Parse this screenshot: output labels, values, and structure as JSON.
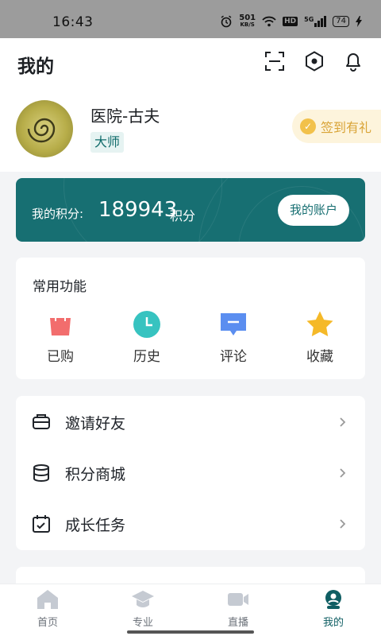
{
  "status_bar": {
    "time": "16:43",
    "net_speed_value": "501",
    "net_speed_unit": "KB/S",
    "hd_badge": "HD",
    "signal_label": "5G",
    "battery": "74",
    "icons": [
      "alarm-icon",
      "wifi-icon",
      "signal-icon",
      "battery-icon",
      "charging-icon"
    ]
  },
  "header": {
    "title": "我的",
    "icons": [
      "scan-icon",
      "settings-icon",
      "bell-icon"
    ]
  },
  "profile": {
    "name": "医院-古夫",
    "level": "大师",
    "checkin_label": "签到有礼"
  },
  "points": {
    "label": "我的积分:",
    "value": "189943",
    "unit": "积分",
    "account_button": "我的账户"
  },
  "common_functions": {
    "title": "常用功能",
    "items": [
      {
        "label": "已购",
        "icon": "shopping-bag-icon",
        "color": "#f26d6d"
      },
      {
        "label": "历史",
        "icon": "clock-icon",
        "color": "#37c3c0"
      },
      {
        "label": "评论",
        "icon": "comment-icon",
        "color": "#5b8ef0"
      },
      {
        "label": "收藏",
        "icon": "star-icon",
        "color": "#f5b928"
      }
    ]
  },
  "menu": {
    "items": [
      {
        "label": "邀请好友",
        "icon": "invite-icon"
      },
      {
        "label": "积分商城",
        "icon": "coins-stack-icon"
      },
      {
        "label": "成长任务",
        "icon": "calendar-check-icon"
      }
    ]
  },
  "tabbar": {
    "items": [
      {
        "label": "首页",
        "icon": "home-icon",
        "active": false
      },
      {
        "label": "专业",
        "icon": "graduation-cap-icon",
        "active": false
      },
      {
        "label": "直播",
        "icon": "video-camera-icon",
        "active": false
      },
      {
        "label": "我的",
        "icon": "profile-icon",
        "active": true
      }
    ]
  },
  "colors": {
    "accent": "#176f72",
    "accent_dark": "#0f5e63",
    "badge_bg": "#e6f3f2",
    "checkin_bg": "#fdf4dc",
    "checkin_text": "#d9a437",
    "page_bg": "#f3f4f6"
  }
}
